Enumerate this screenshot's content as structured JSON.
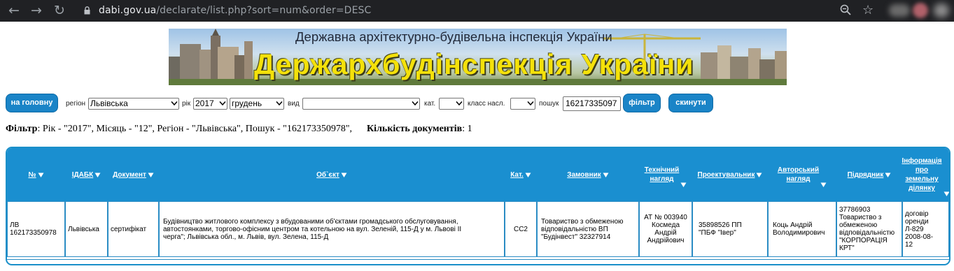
{
  "browser": {
    "url_host": "dabi.gov.ua",
    "url_path": "/declarate/list.php?sort=num&order=DESC"
  },
  "banner": {
    "subtitle": "Державна архітектурно-будівельна інспекція України",
    "title": "Держархбудінспекція України"
  },
  "form": {
    "home_button": "на головну",
    "region_label": "регіон",
    "region_value": "Львівська",
    "year_label": "рік",
    "year_value": "2017",
    "month_value": "грудень",
    "type_label": "вид",
    "type_value": "",
    "category_label": "кат.",
    "category_value": "",
    "class_label": "класс насл.",
    "class_value": "",
    "search_label": "пошук",
    "search_value": "16217335097",
    "filter_button": "фільтр",
    "reset_button": "скинути"
  },
  "filter_summary": {
    "label": "Фільтр",
    "text": ": Рік - \"2017\", Місяць - \"12\", Регіон - \"Львівська\", Пошук - \"162173350978\",",
    "count_label": "Кількість документів",
    "count_value": ": 1"
  },
  "table": {
    "headers": [
      "№",
      "ІДАБК",
      "Документ",
      "Об`єкт",
      "Кат.",
      "Замовник",
      "Технічний\nнагляд",
      "Проектувальник",
      "Авторський\nнагляд",
      "Підрядник",
      "Інформація\nпро\nземельну\nділянку"
    ],
    "rows": [
      [
        "ЛВ\n162173350978",
        "Львівська",
        "сертифікат",
        "Будівництво житлового комплексу з вбудованими об'єктами громадського обслуговування,\nавтостоянками, торгово-офісним центром та котельною на вул. Зеленій, 115-Д у м. Львові ІІ\nчерга\"; Львівська обл., м. Львів, вул. Зелена, 115-Д",
        "СС2",
        "Товариство з обмеженою\nвідповідальністю ВП\n\"Будінвест\" 32327914",
        "АТ № 003940\nКосмеда\nАндрій\nАндрійович",
        "35898526 ПП\n\"ПБФ \"Івер\"",
        "Коць Андрій\nВолодимирович",
        "37786903\nТовариство з\nобмеженою\nвідповідальністю\n\"КОРПОРАЦІЯ\nКРТ\"",
        "договір\nоренди\nЛ-829\n2008-08-\n12"
      ]
    ]
  }
}
